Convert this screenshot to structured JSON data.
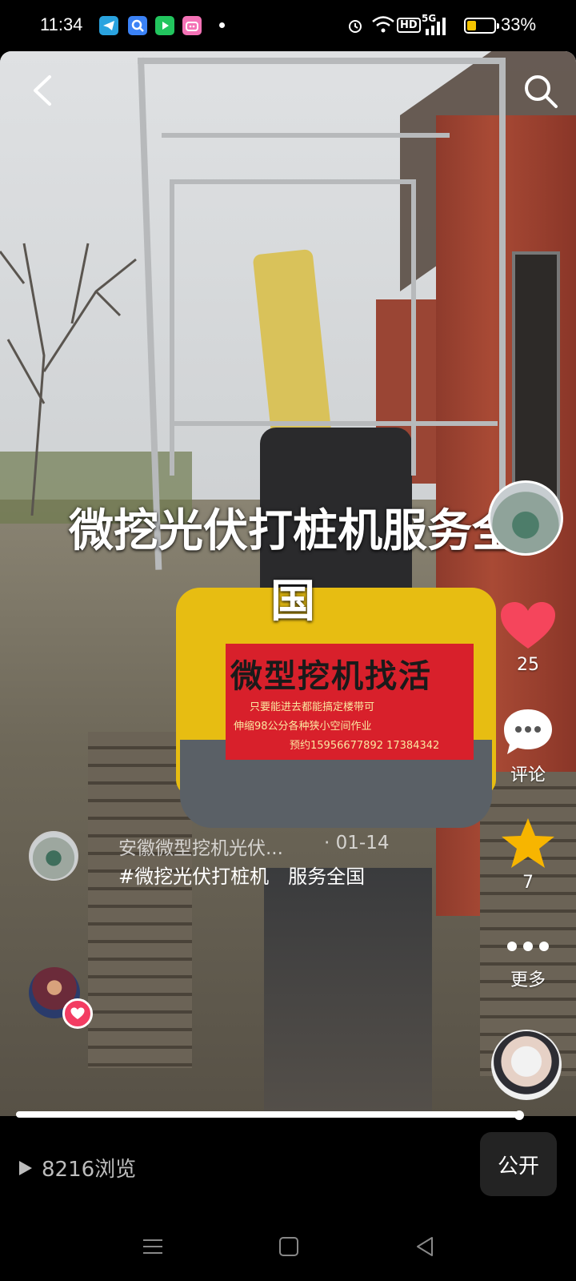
{
  "status_bar": {
    "time": "11:34",
    "battery_percent": "33%",
    "network": "5G",
    "hd_label": "HD",
    "battery_level": 0.33,
    "battery_color": "#f5c400",
    "app_icons": [
      "telegram-icon",
      "search-app-icon",
      "video-app-icon",
      "bilibili-icon"
    ]
  },
  "video": {
    "caption": "微挖光伏打桩机服务全国",
    "sign_text": "微型挖机找活",
    "sign_line1": "只要能进去都能搞定楼带可",
    "sign_line2": "伸缩98公分各种狭小空间作业",
    "sign_line3": "预约15956677892 17384342"
  },
  "actions": {
    "like_count": "25",
    "comment_label": "评论",
    "favorite_count": "7",
    "more_label": "更多",
    "like_color": "#f5455c",
    "star_color": "#f7b500"
  },
  "post": {
    "author": "安徽微型挖机光伏...",
    "date": "· 01-14",
    "text": "#微挖光伏打桩机　服务全国"
  },
  "progress": {
    "fraction": 0.97
  },
  "bottom": {
    "views": "8216浏览",
    "public_label": "公开"
  }
}
